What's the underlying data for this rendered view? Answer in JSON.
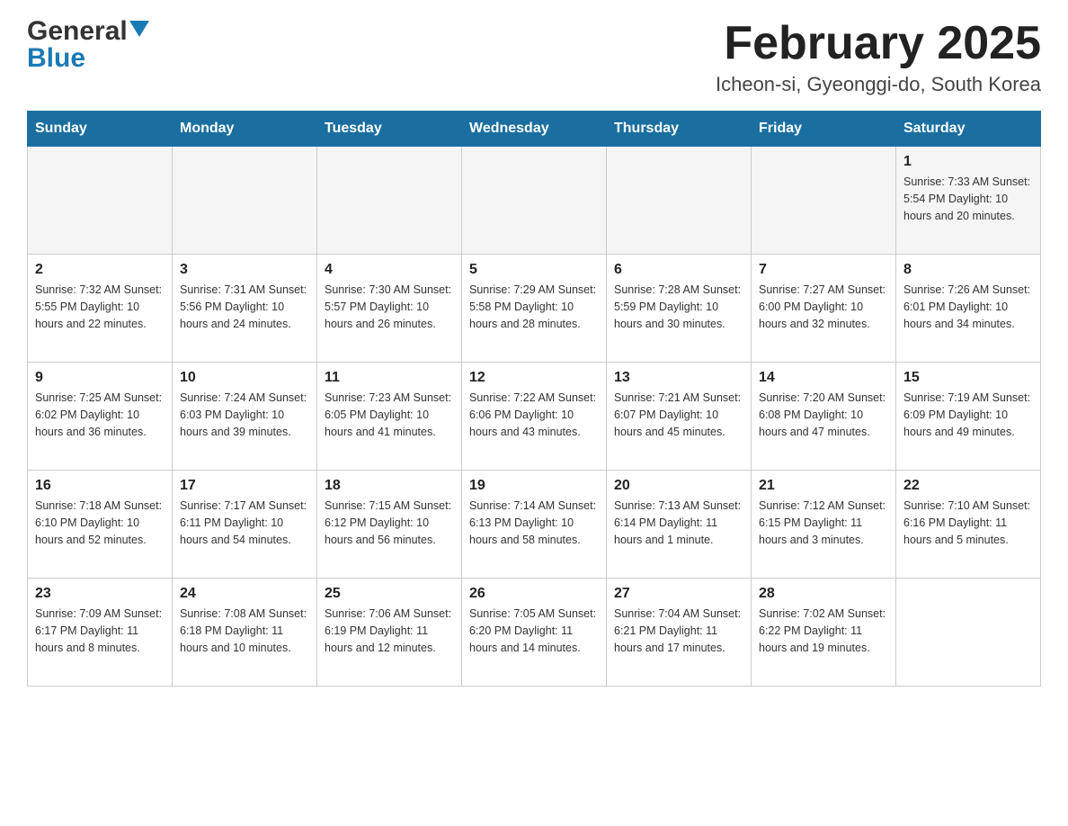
{
  "header": {
    "logo": {
      "general": "General",
      "blue": "Blue"
    },
    "month_title": "February 2025",
    "location": "Icheon-si, Gyeonggi-do, South Korea"
  },
  "calendar": {
    "days_of_week": [
      "Sunday",
      "Monday",
      "Tuesday",
      "Wednesday",
      "Thursday",
      "Friday",
      "Saturday"
    ],
    "weeks": [
      {
        "days": [
          {
            "number": "",
            "info": ""
          },
          {
            "number": "",
            "info": ""
          },
          {
            "number": "",
            "info": ""
          },
          {
            "number": "",
            "info": ""
          },
          {
            "number": "",
            "info": ""
          },
          {
            "number": "",
            "info": ""
          },
          {
            "number": "1",
            "info": "Sunrise: 7:33 AM\nSunset: 5:54 PM\nDaylight: 10 hours\nand 20 minutes."
          }
        ]
      },
      {
        "days": [
          {
            "number": "2",
            "info": "Sunrise: 7:32 AM\nSunset: 5:55 PM\nDaylight: 10 hours\nand 22 minutes."
          },
          {
            "number": "3",
            "info": "Sunrise: 7:31 AM\nSunset: 5:56 PM\nDaylight: 10 hours\nand 24 minutes."
          },
          {
            "number": "4",
            "info": "Sunrise: 7:30 AM\nSunset: 5:57 PM\nDaylight: 10 hours\nand 26 minutes."
          },
          {
            "number": "5",
            "info": "Sunrise: 7:29 AM\nSunset: 5:58 PM\nDaylight: 10 hours\nand 28 minutes."
          },
          {
            "number": "6",
            "info": "Sunrise: 7:28 AM\nSunset: 5:59 PM\nDaylight: 10 hours\nand 30 minutes."
          },
          {
            "number": "7",
            "info": "Sunrise: 7:27 AM\nSunset: 6:00 PM\nDaylight: 10 hours\nand 32 minutes."
          },
          {
            "number": "8",
            "info": "Sunrise: 7:26 AM\nSunset: 6:01 PM\nDaylight: 10 hours\nand 34 minutes."
          }
        ]
      },
      {
        "days": [
          {
            "number": "9",
            "info": "Sunrise: 7:25 AM\nSunset: 6:02 PM\nDaylight: 10 hours\nand 36 minutes."
          },
          {
            "number": "10",
            "info": "Sunrise: 7:24 AM\nSunset: 6:03 PM\nDaylight: 10 hours\nand 39 minutes."
          },
          {
            "number": "11",
            "info": "Sunrise: 7:23 AM\nSunset: 6:05 PM\nDaylight: 10 hours\nand 41 minutes."
          },
          {
            "number": "12",
            "info": "Sunrise: 7:22 AM\nSunset: 6:06 PM\nDaylight: 10 hours\nand 43 minutes."
          },
          {
            "number": "13",
            "info": "Sunrise: 7:21 AM\nSunset: 6:07 PM\nDaylight: 10 hours\nand 45 minutes."
          },
          {
            "number": "14",
            "info": "Sunrise: 7:20 AM\nSunset: 6:08 PM\nDaylight: 10 hours\nand 47 minutes."
          },
          {
            "number": "15",
            "info": "Sunrise: 7:19 AM\nSunset: 6:09 PM\nDaylight: 10 hours\nand 49 minutes."
          }
        ]
      },
      {
        "days": [
          {
            "number": "16",
            "info": "Sunrise: 7:18 AM\nSunset: 6:10 PM\nDaylight: 10 hours\nand 52 minutes."
          },
          {
            "number": "17",
            "info": "Sunrise: 7:17 AM\nSunset: 6:11 PM\nDaylight: 10 hours\nand 54 minutes."
          },
          {
            "number": "18",
            "info": "Sunrise: 7:15 AM\nSunset: 6:12 PM\nDaylight: 10 hours\nand 56 minutes."
          },
          {
            "number": "19",
            "info": "Sunrise: 7:14 AM\nSunset: 6:13 PM\nDaylight: 10 hours\nand 58 minutes."
          },
          {
            "number": "20",
            "info": "Sunrise: 7:13 AM\nSunset: 6:14 PM\nDaylight: 11 hours\nand 1 minute."
          },
          {
            "number": "21",
            "info": "Sunrise: 7:12 AM\nSunset: 6:15 PM\nDaylight: 11 hours\nand 3 minutes."
          },
          {
            "number": "22",
            "info": "Sunrise: 7:10 AM\nSunset: 6:16 PM\nDaylight: 11 hours\nand 5 minutes."
          }
        ]
      },
      {
        "days": [
          {
            "number": "23",
            "info": "Sunrise: 7:09 AM\nSunset: 6:17 PM\nDaylight: 11 hours\nand 8 minutes."
          },
          {
            "number": "24",
            "info": "Sunrise: 7:08 AM\nSunset: 6:18 PM\nDaylight: 11 hours\nand 10 minutes."
          },
          {
            "number": "25",
            "info": "Sunrise: 7:06 AM\nSunset: 6:19 PM\nDaylight: 11 hours\nand 12 minutes."
          },
          {
            "number": "26",
            "info": "Sunrise: 7:05 AM\nSunset: 6:20 PM\nDaylight: 11 hours\nand 14 minutes."
          },
          {
            "number": "27",
            "info": "Sunrise: 7:04 AM\nSunset: 6:21 PM\nDaylight: 11 hours\nand 17 minutes."
          },
          {
            "number": "28",
            "info": "Sunrise: 7:02 AM\nSunset: 6:22 PM\nDaylight: 11 hours\nand 19 minutes."
          },
          {
            "number": "",
            "info": ""
          }
        ]
      }
    ]
  }
}
